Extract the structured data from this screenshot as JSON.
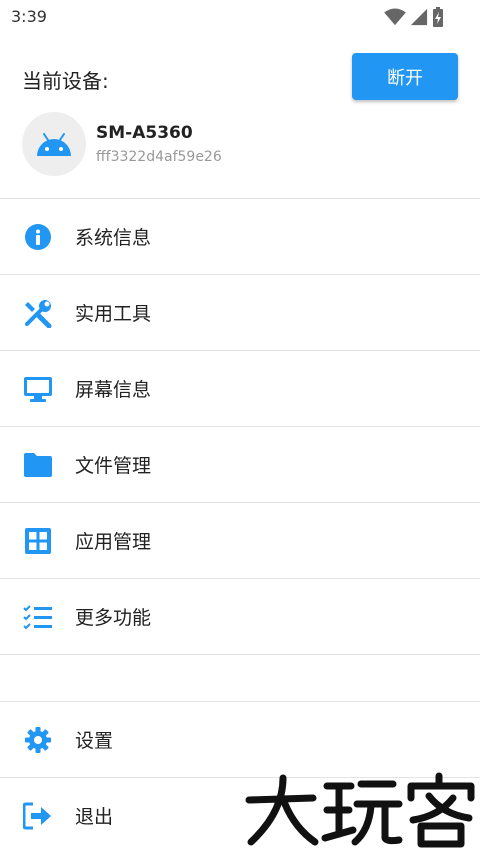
{
  "status_bar": {
    "time": "3:39"
  },
  "device": {
    "current_label": "当前设备:",
    "disconnect_label": "断开",
    "name": "SM-A5360",
    "serial": "fff3322d4af59e26"
  },
  "menu": [
    {
      "label": "系统信息",
      "icon": "info-icon"
    },
    {
      "label": "实用工具",
      "icon": "tools-icon"
    },
    {
      "label": "屏幕信息",
      "icon": "monitor-icon"
    },
    {
      "label": "文件管理",
      "icon": "folder-icon"
    },
    {
      "label": "应用管理",
      "icon": "apps-grid-icon"
    },
    {
      "label": "更多功能",
      "icon": "checklist-icon"
    }
  ],
  "bottom_menu": [
    {
      "label": "设置",
      "icon": "gear-icon"
    },
    {
      "label": "退出",
      "icon": "exit-icon"
    }
  ],
  "colors": {
    "accent": "#2196f3",
    "divider": "#e4e4e4",
    "muted_text": "#999999"
  }
}
